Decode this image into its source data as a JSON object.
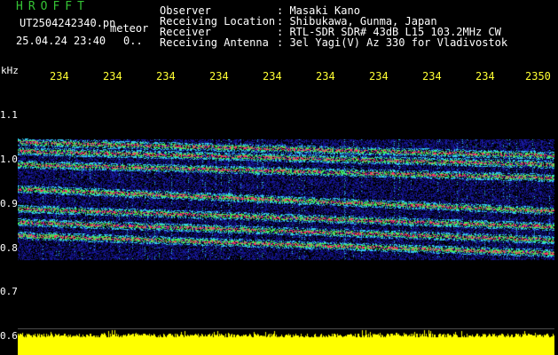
{
  "header": {
    "app_title": "HROFFT",
    "filename": "UT2504242340.pn",
    "meteor_label": "meteor",
    "datetime": "25.04.24 23:40",
    "count": "0.."
  },
  "station_info": [
    {
      "label": "Observer",
      "value": ": Masaki Kano"
    },
    {
      "label": "Receiving Location",
      "value": ": Shibukawa, Gunma, Japan"
    },
    {
      "label": "Receiver",
      "value": ": RTL-SDR SDR# 43dB L15 103.2MHz CW"
    },
    {
      "label": "Receiving Antenna",
      "value": ": 3el Yagi(V) Az 330 for Vladivostok"
    }
  ],
  "axis": {
    "y_unit": "kHz",
    "x_ticks": [
      "234",
      "234",
      "234",
      "234",
      "234",
      "234",
      "234",
      "234",
      "234",
      "2350"
    ],
    "y_ticks": [
      "1.1",
      "1.0",
      "0.9",
      "0.8",
      "0.7",
      "0.6"
    ]
  },
  "colors": {
    "background": "#000000",
    "noise": "#1a1aa0",
    "signal_cyan": "#33ccee",
    "signal_green": "#44ee55",
    "signal_red": "#ff3366",
    "meter_yellow": "#ffff00",
    "title_green": "#35c435",
    "tick_yellow": "#ffff33"
  },
  "spectrogram": {
    "traces": [
      {
        "start_khz": 1.04,
        "end_khz": 1.01,
        "strength": 0.6
      },
      {
        "start_khz": 1.02,
        "end_khz": 0.99,
        "strength": 0.8
      },
      {
        "start_khz": 0.99,
        "end_khz": 0.96,
        "strength": 0.7
      },
      {
        "start_khz": 0.935,
        "end_khz": 0.885,
        "strength": 1.0
      },
      {
        "start_khz": 0.89,
        "end_khz": 0.85,
        "strength": 0.8
      },
      {
        "start_khz": 0.86,
        "end_khz": 0.82,
        "strength": 0.6
      },
      {
        "start_khz": 0.83,
        "end_khz": 0.79,
        "strength": 1.0
      }
    ]
  }
}
